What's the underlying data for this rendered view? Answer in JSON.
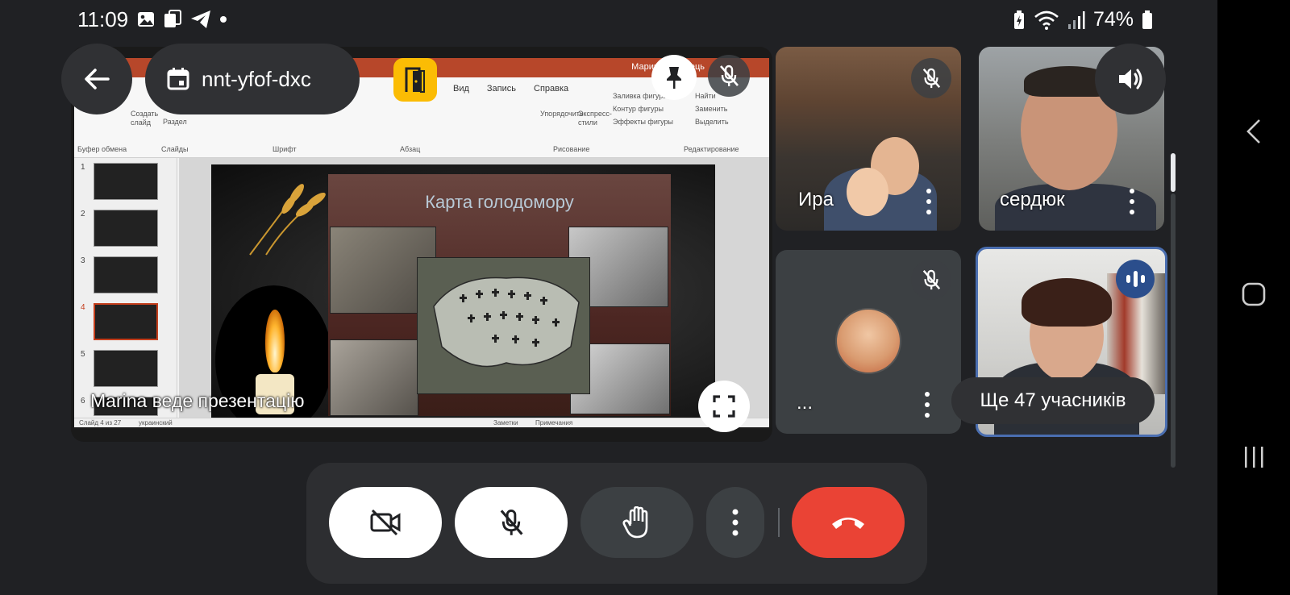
{
  "status_bar": {
    "time": "11:09",
    "battery": "74%",
    "left_icons": [
      "gallery-icon",
      "copy-icon",
      "telegram-icon",
      "notification-dot-icon"
    ],
    "right_icons": [
      "battery-saver-icon",
      "wifi-icon",
      "signal-icon",
      "battery-icon"
    ]
  },
  "header": {
    "meeting_code": "nnt-yfof-dxc"
  },
  "presentation": {
    "presenter_label": "Marina веде презентацію",
    "app": {
      "owner": "Марина Горобець",
      "ribbon_tabs": [
        "Вид",
        "Запись",
        "Справка"
      ],
      "ribbon_groups": [
        "Буфер обмена",
        "Слайды",
        "Шрифт",
        "Абзац",
        "Рисование",
        "Редактирование"
      ],
      "ribbon_buttons": {
        "create_slide": "Создать слайд",
        "section": "Раздел",
        "arrange": "Упорядочить",
        "express_styles": "Экспресс-стили",
        "fill": "Заливка фигуры",
        "outline": "Контур фигуры",
        "effects": "Эффекты фигуры",
        "find": "Найти",
        "replace": "Заменить",
        "select": "Выделить"
      },
      "slide_numbers": [
        "1",
        "2",
        "3",
        "4",
        "5",
        "6"
      ],
      "active_slide": 4,
      "status": {
        "slide_counter": "Слайд 4 из 27",
        "language": "украинский",
        "notes": "Заметки",
        "comments": "Примечания"
      }
    },
    "slide": {
      "title": "Карта голодомору"
    }
  },
  "participants": [
    {
      "name": "Ира",
      "muted": true
    },
    {
      "name": "сердюк",
      "muted": false
    },
    {
      "name": "...",
      "muted": true
    },
    {
      "name": "Ще 47 учасників",
      "speaking": true
    }
  ],
  "colors": {
    "background": "#202124",
    "surface": "#303134",
    "end_call": "#ea4335",
    "speaking_border": "#4a6eb0",
    "accent_yellow": "#fbbc04",
    "ppt_red": "#b7472a"
  },
  "controls": {
    "camera": "camera-off-icon",
    "mic": "mic-off-icon",
    "hand": "raise-hand-icon",
    "more": "more-vert-icon",
    "end": "end-call-icon"
  }
}
